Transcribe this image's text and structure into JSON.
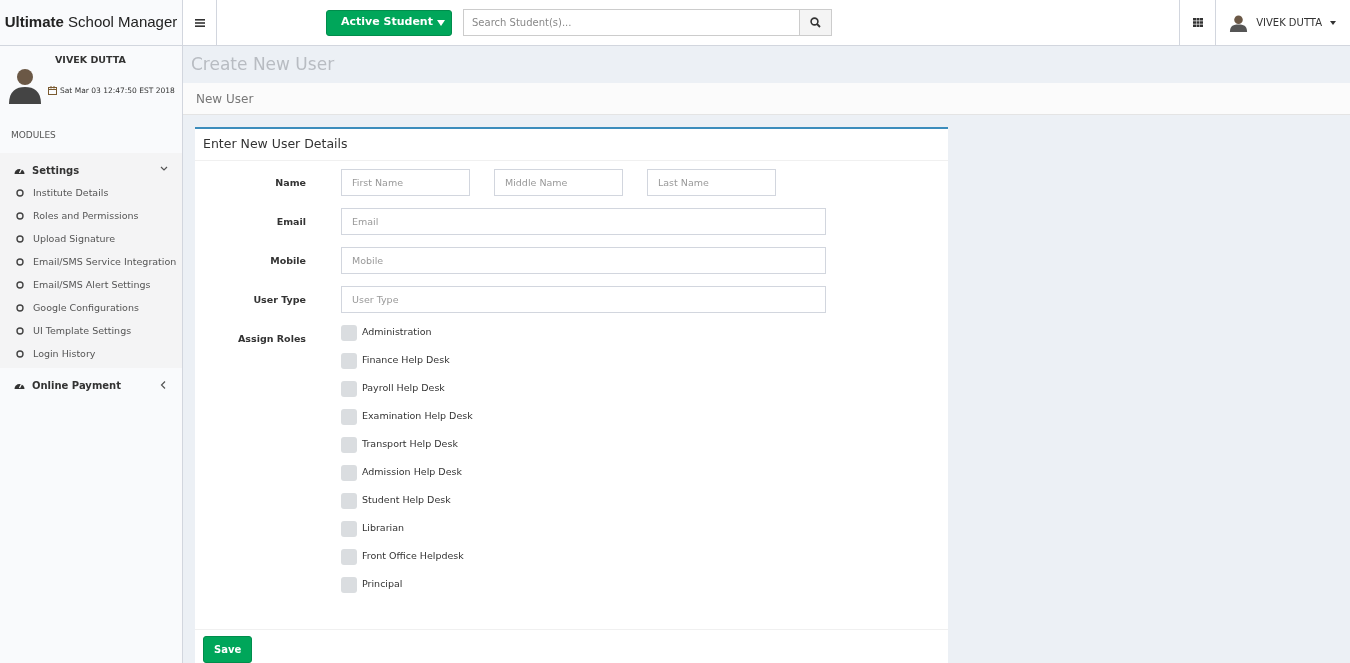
{
  "app_title": "**Ultimate** School Manager",
  "header": {
    "student_filter": "Active Student",
    "search": {
      "placeholder": "Search Student(s)..."
    },
    "user_name": "VIVEK DUTTA"
  },
  "sidebar": {
    "user_name": "VIVEK DUTTA",
    "datetime": "Sat Mar 03 12:47:50 EST 2018",
    "section_label": "MODULES",
    "items": [
      {
        "label": "Settings",
        "expanded": true,
        "children": [
          {
            "label": "Institute Details"
          },
          {
            "label": "Roles and Permissions"
          },
          {
            "label": "Upload Signature"
          },
          {
            "label": "Email/SMS Service Integration"
          },
          {
            "label": "Email/SMS Alert Settings"
          },
          {
            "label": "Google Configurations"
          },
          {
            "label": "UI Template Settings"
          },
          {
            "label": "Login History"
          }
        ]
      },
      {
        "label": "Online Payment",
        "expanded": false
      }
    ]
  },
  "page_title": "Create New User",
  "breadcrumb": "New User",
  "form": {
    "title": "Enter New User Details",
    "name_label": "Name",
    "name_fields": [
      {
        "placeholder": "First Name"
      },
      {
        "placeholder": "Middle Name"
      },
      {
        "placeholder": "Last Name"
      }
    ],
    "fields": [
      {
        "label": "Email",
        "placeholder": "Email"
      },
      {
        "label": "Mobile",
        "placeholder": "Mobile"
      },
      {
        "label": "User Type",
        "placeholder": "User Type"
      }
    ],
    "roles_label": "Assign Roles",
    "roles": [
      {
        "label": "Administration",
        "checked": false
      },
      {
        "label": "Finance Help Desk",
        "checked": false
      },
      {
        "label": "Payroll Help Desk",
        "checked": false
      },
      {
        "label": "Examination Help Desk",
        "checked": false
      },
      {
        "label": "Transport Help Desk",
        "checked": false
      },
      {
        "label": "Admission Help Desk",
        "checked": false
      },
      {
        "label": "Student Help Desk",
        "checked": false
      },
      {
        "label": "Librarian",
        "checked": false
      },
      {
        "label": "Front Office Helpdesk",
        "checked": false
      },
      {
        "label": "Principal",
        "checked": false
      }
    ],
    "save_button": "Save"
  }
}
